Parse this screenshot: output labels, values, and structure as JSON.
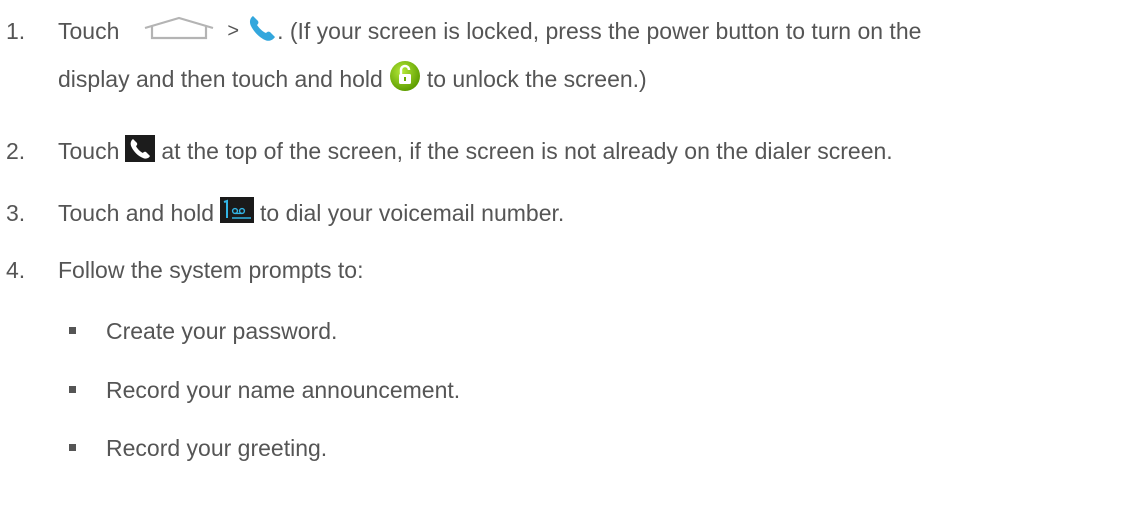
{
  "steps": [
    {
      "number": "1.",
      "part1": "Touch",
      "sep": ">",
      "part2": ". (If your screen is locked, press the power button to turn on the",
      "part3": "display and then touch and hold",
      "part4": "to unlock the screen.)"
    },
    {
      "number": "2.",
      "part1": "Touch",
      "part2": "at the top of the screen, if the screen is not already on the dialer screen."
    },
    {
      "number": "3.",
      "part1": "Touch and hold",
      "part2": "to dial your voicemail number."
    },
    {
      "number": "4.",
      "part1": "Follow the system prompts to:"
    }
  ],
  "sub_items": [
    "Create your password.",
    "Record your name announcement.",
    "Record your greeting."
  ],
  "icons": {
    "home": "home-icon",
    "phone": "phone-icon",
    "unlock": "unlock-icon",
    "phone_tab": "phone-tab-icon",
    "voicemail_key": "voicemail-key-icon"
  },
  "colors": {
    "text": "#555555",
    "phone_blue": "#33a7dd",
    "unlock_green": "#7dc400",
    "voicemail_key_bg": "#1a1a1a",
    "voicemail_key_fg": "#33b5e5"
  }
}
